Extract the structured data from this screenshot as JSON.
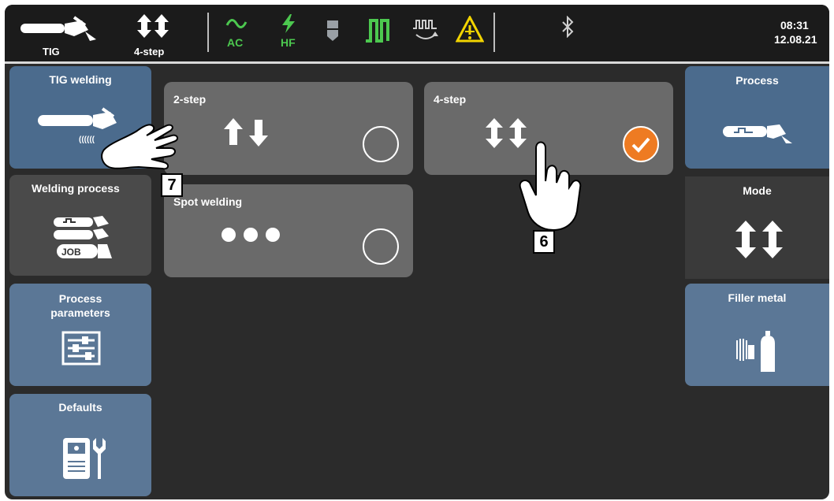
{
  "topbar": {
    "process_label": "TIG",
    "mode_label": "4-step",
    "ac_label": "AC",
    "hf_label": "HF",
    "time": "08:31",
    "date": "12.08.21"
  },
  "sidebar": {
    "items": [
      {
        "label": "TIG welding"
      },
      {
        "label": "Welding process",
        "badge": "JOB"
      },
      {
        "label": "Process\nparameters"
      },
      {
        "label": "Defaults"
      }
    ]
  },
  "main": {
    "cards": [
      {
        "label": "2-step",
        "selected": false
      },
      {
        "label": "4-step",
        "selected": true
      },
      {
        "label": "Spot welding",
        "selected": false
      }
    ]
  },
  "right_panel": {
    "items": [
      {
        "label": "Process"
      },
      {
        "label": "Mode"
      },
      {
        "label": "Filler metal"
      }
    ]
  },
  "callouts": {
    "callout_7": "7",
    "callout_6": "6"
  },
  "colors": {
    "nav_active": "#4b6b8d",
    "nav_default": "#5b7796",
    "card_bg": "#6a6a6a",
    "accent_check": "#ee7b22",
    "status_green": "#4cc84f",
    "warning_yellow": "#f2d400"
  }
}
